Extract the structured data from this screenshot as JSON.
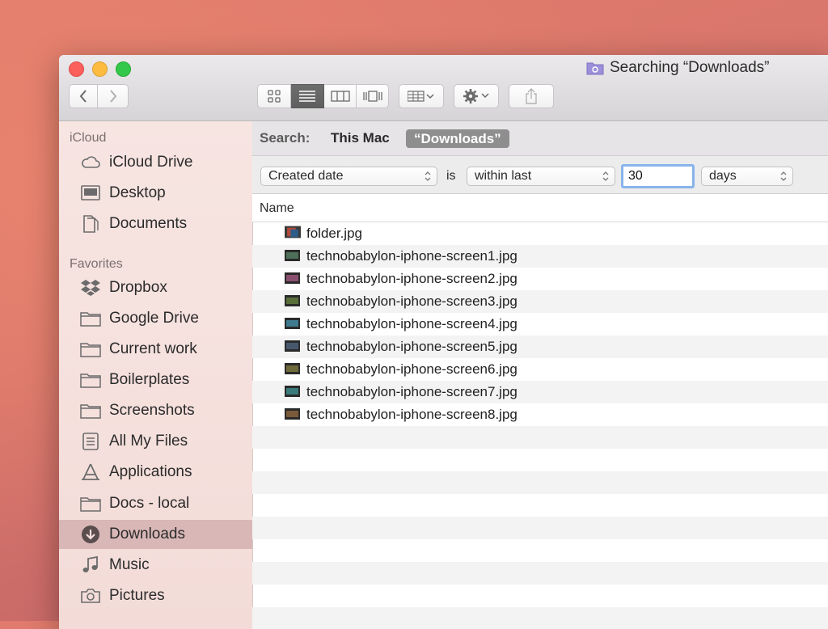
{
  "window": {
    "title": "Searching “Downloads”",
    "title_icon": "folder-search-icon"
  },
  "toolbar": {
    "back_icon": "chevron-left-icon",
    "forward_icon": "chevron-right-icon",
    "view_modes": [
      "icon-view",
      "list-view",
      "column-view",
      "cover-flow-view"
    ],
    "active_view": "list-view",
    "group_icon": "group-by-icon",
    "action_icon": "gear-icon",
    "share_icon": "share-icon"
  },
  "sidebar": {
    "icloud_header": "iCloud",
    "icloud_items": [
      {
        "label": "iCloud Drive",
        "icon": "cloud-icon"
      },
      {
        "label": "Desktop",
        "icon": "desktop-icon"
      },
      {
        "label": "Documents",
        "icon": "documents-icon"
      }
    ],
    "favorites_header": "Favorites",
    "favorites_items": [
      {
        "label": "Dropbox",
        "icon": "dropbox-icon"
      },
      {
        "label": "Google Drive",
        "icon": "folder-icon"
      },
      {
        "label": "Current work",
        "icon": "folder-icon"
      },
      {
        "label": "Boilerplates",
        "icon": "folder-icon"
      },
      {
        "label": "Screenshots",
        "icon": "folder-icon"
      },
      {
        "label": "All My Files",
        "icon": "all-files-icon"
      },
      {
        "label": "Applications",
        "icon": "applications-icon"
      },
      {
        "label": "Docs - local",
        "icon": "folder-icon"
      },
      {
        "label": "Downloads",
        "icon": "downloads-icon",
        "selected": true
      },
      {
        "label": "Music",
        "icon": "music-icon"
      },
      {
        "label": "Pictures",
        "icon": "camera-icon"
      }
    ]
  },
  "search": {
    "label": "Search:",
    "scope_this_mac": "This Mac",
    "scope_folder": "“Downloads”"
  },
  "criteria": {
    "attribute": "Created date",
    "operator_word": "is",
    "condition": "within last",
    "value": "30",
    "unit": "days"
  },
  "list": {
    "column_name": "Name",
    "files": [
      "folder.jpg",
      "technobabylon-iphone-screen1.jpg",
      "technobabylon-iphone-screen2.jpg",
      "technobabylon-iphone-screen3.jpg",
      "technobabylon-iphone-screen4.jpg",
      "technobabylon-iphone-screen5.jpg",
      "technobabylon-iphone-screen6.jpg",
      "technobabylon-iphone-screen7.jpg",
      "technobabylon-iphone-screen8.jpg"
    ]
  },
  "colors": {
    "selected_sidebar": "#d9b7b7",
    "focus_ring": "#87b4ec",
    "scope_selected": "#8e8e8e"
  }
}
